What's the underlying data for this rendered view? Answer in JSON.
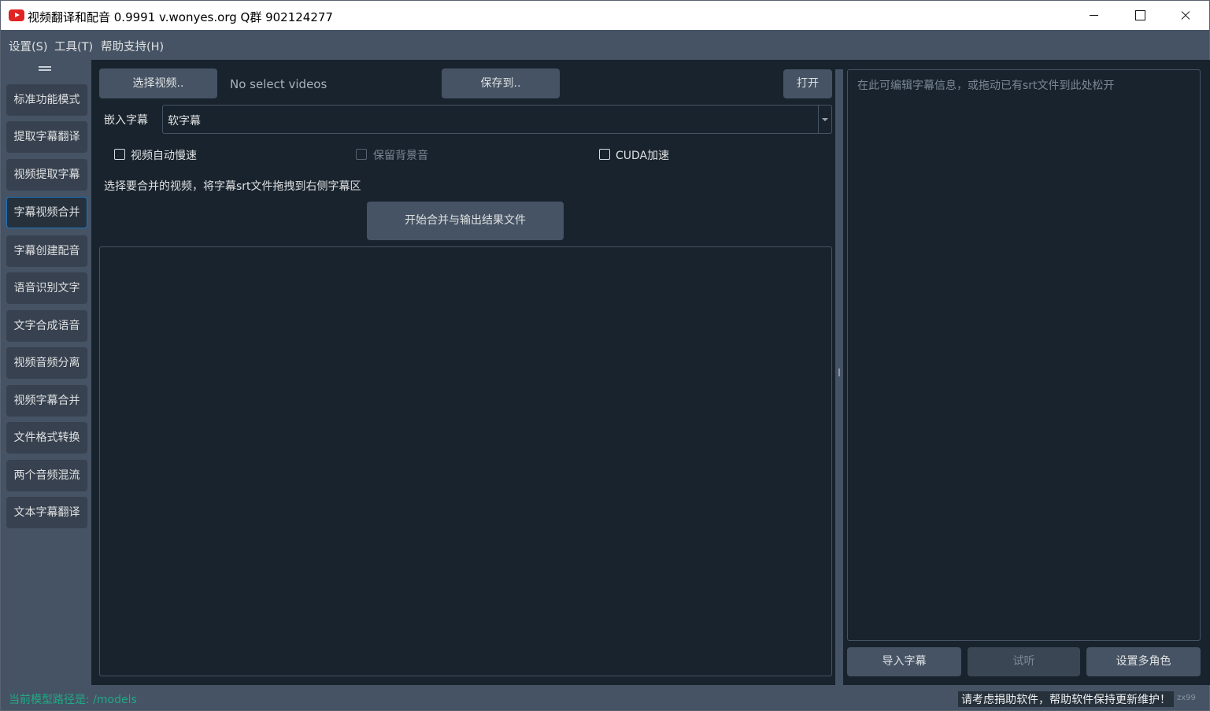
{
  "window": {
    "title": "视频翻译和配音 0.9991 v.wonyes.org   Q群 902124277"
  },
  "menu": [
    "设置(S)",
    "工具(T)",
    "帮助支持(H)"
  ],
  "sidebar": {
    "items": [
      {
        "label": "标准功能模式"
      },
      {
        "label": "提取字幕翻译"
      },
      {
        "label": "视频提取字幕"
      },
      {
        "label": "字幕视频合并",
        "active": true
      },
      {
        "label": "字幕创建配音"
      },
      {
        "label": "语音识别文字"
      },
      {
        "label": "文字合成语音"
      },
      {
        "label": "视频音频分离"
      },
      {
        "label": "视频字幕合并"
      },
      {
        "label": "文件格式转换"
      },
      {
        "label": "两个音频混流"
      },
      {
        "label": "文本字幕翻译"
      }
    ]
  },
  "main": {
    "select_video_label": "选择视频..",
    "selected_video_text": "No select videos",
    "save_to_label": "保存到..",
    "open_label": "打开",
    "embed_subtitle_label": "嵌入字幕",
    "embed_subtitle_value": "软字幕",
    "checkboxes": {
      "auto_slow": {
        "label": "视频自动慢速",
        "checked": false
      },
      "keep_bg": {
        "label": "保留背景音",
        "checked": false,
        "disabled": true
      },
      "cuda": {
        "label": "CUDA加速",
        "checked": false
      }
    },
    "hint": "选择要合并的视频，将字幕srt文件拖拽到右侧字幕区",
    "start_label": "开始合并与输出结果文件"
  },
  "subtitle_panel": {
    "placeholder": "在此可编辑字幕信息，或拖动已有srt文件到此处松开",
    "import_label": "导入字幕",
    "listen_label": "试听",
    "roles_label": "设置多角色"
  },
  "status": {
    "model_path": "当前模型路径是: /models",
    "donate": "请考虑捐助软件，帮助软件保持更新维护！",
    "corner": "zx99"
  },
  "colors": {
    "background": "#19232d",
    "panel": "#455364",
    "accent": "#1a72bb",
    "status_path": "#21a884"
  }
}
